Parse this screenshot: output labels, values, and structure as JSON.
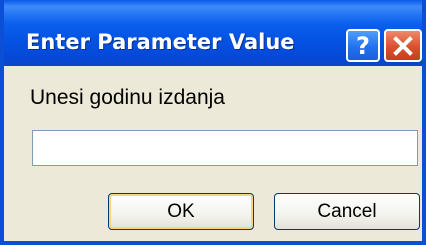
{
  "window": {
    "title": "Enter Parameter Value",
    "help_icon": "question-mark-icon",
    "close_icon": "close-x-icon"
  },
  "dialog": {
    "prompt": "Unesi godinu izdanja",
    "input_value": "",
    "ok_label": "OK",
    "cancel_label": "Cancel"
  },
  "colors": {
    "titlebar": "#0553e3",
    "close_button": "#d9512d",
    "dialog_background": "#ece9d8"
  }
}
